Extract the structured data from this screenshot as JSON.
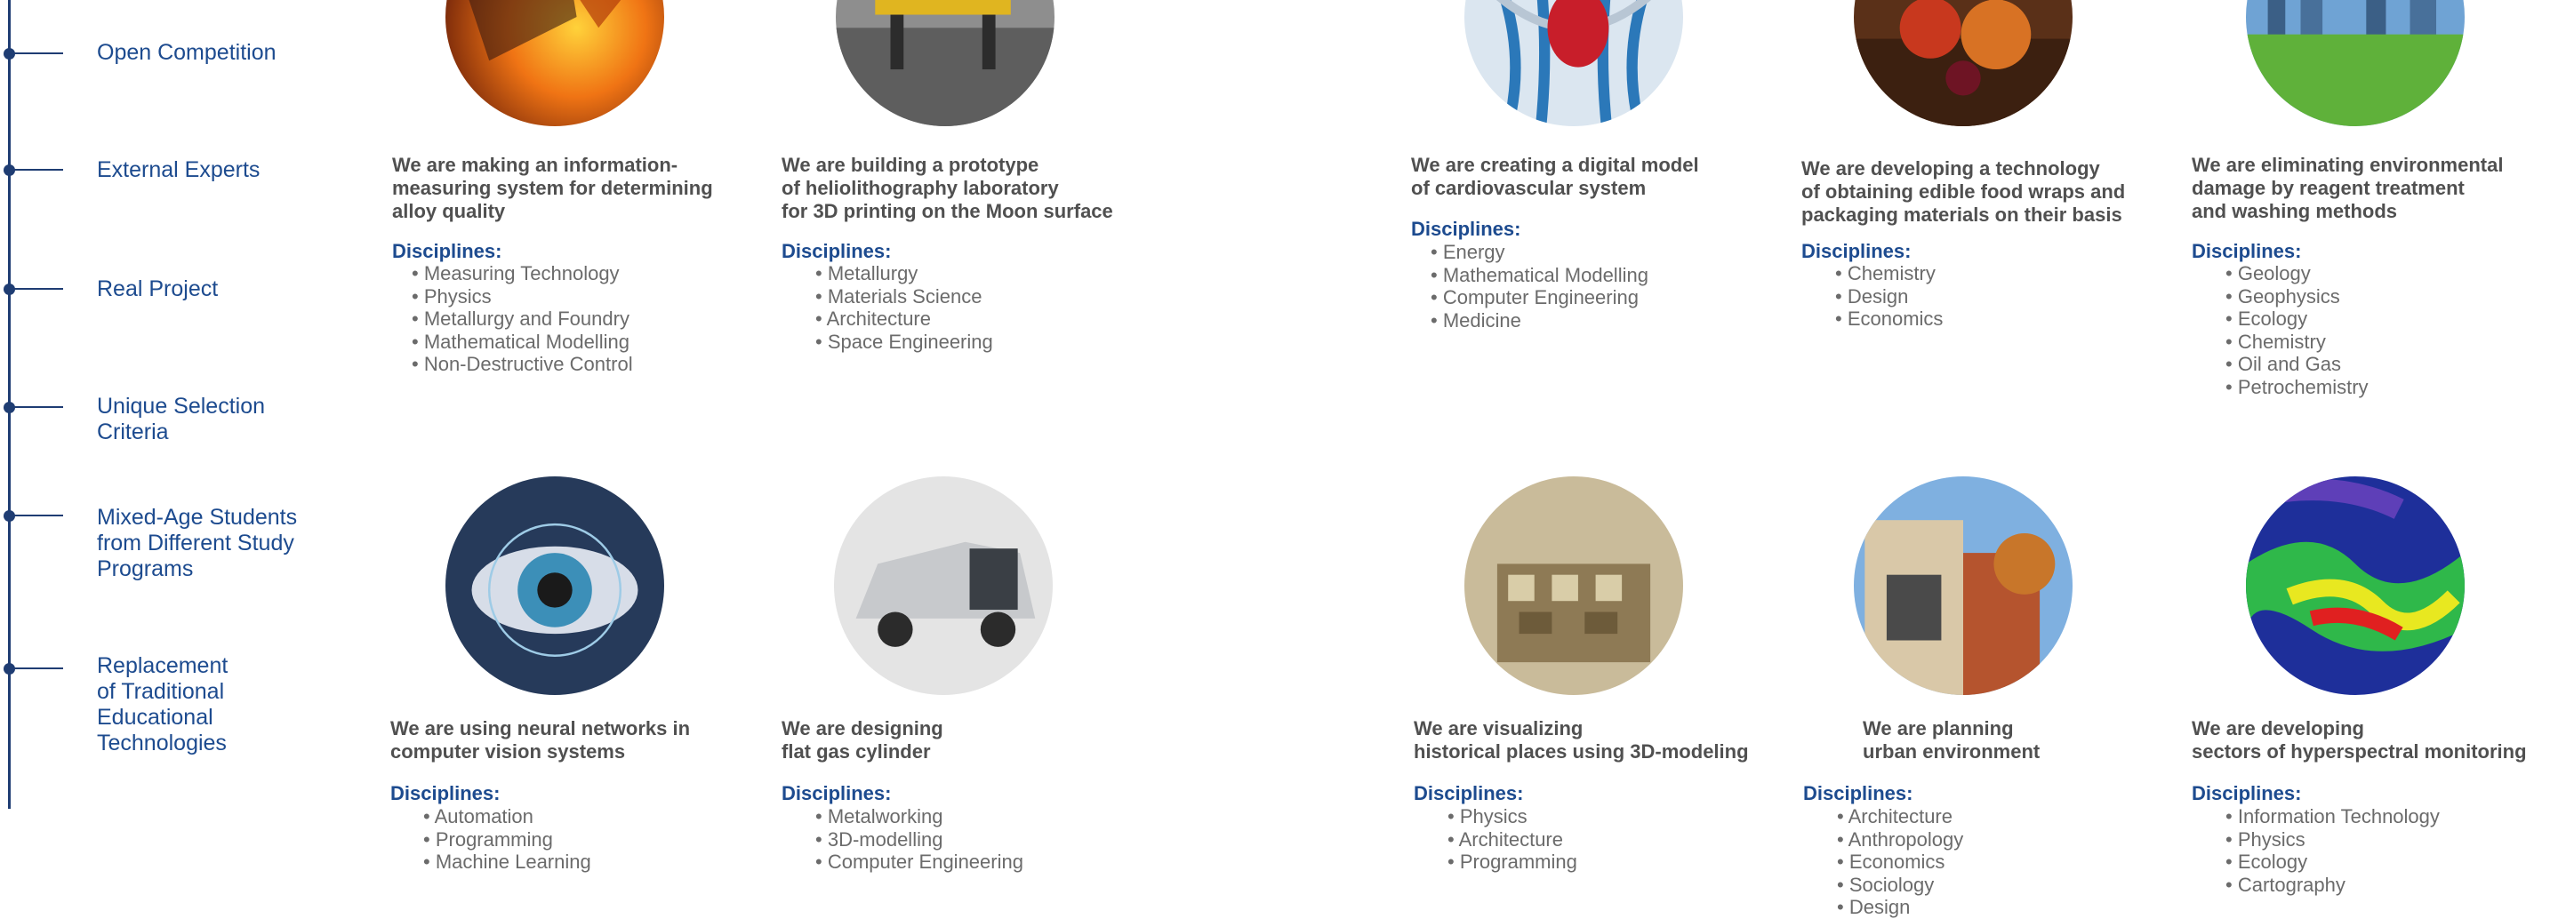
{
  "timeline": [
    {
      "label": "Open Competition"
    },
    {
      "label": "External Experts"
    },
    {
      "label": "Real Project"
    },
    {
      "label": "Unique Selection\nCriteria"
    },
    {
      "label": "Mixed-Age Students\nfrom Different Study\nPrograms"
    },
    {
      "label": "Replacement\nof Traditional\nEducational\nTechnologies"
    }
  ],
  "disciplines_heading": "Disciplines:",
  "projects": [
    {
      "title": "We are making an information-\nmeasuring system for determining\nalloy quality",
      "image": "molten-metal-image",
      "disciplines": [
        "Measuring Technology",
        "Physics",
        "Metallurgy and Foundry",
        "Mathematical Modelling",
        "Non-Destructive Control"
      ]
    },
    {
      "title": "We are building a prototype\nof heliolithography laboratory\nfor 3D printing on the Moon surface",
      "image": "lunar-rover-image",
      "disciplines": [
        "Metallurgy",
        "Materials Science",
        "Architecture",
        "Space Engineering"
      ]
    },
    {
      "title": "We are creating a digital model\nof cardiovascular system",
      "image": "cardiovascular-image",
      "disciplines": [
        "Energy",
        "Mathematical Modelling",
        "Computer Engineering",
        "Medicine"
      ]
    },
    {
      "title": "We are developing a technology\nof obtaining edible food wraps and\npackaging materials on their basis",
      "image": "fruits-image",
      "disciplines": [
        "Chemistry",
        "Design",
        "Economics"
      ]
    },
    {
      "title": "We are eliminating environmental\ndamage by reagent treatment\nand washing methods",
      "image": "green-city-image",
      "disciplines": [
        "Geology",
        "Geophysics",
        "Ecology",
        "Chemistry",
        "Oil and Gas",
        "Petrochemistry"
      ]
    },
    {
      "title": "We are using neural networks in\ncomputer vision systems",
      "image": "eye-image",
      "disciplines": [
        "Automation",
        "Programming",
        "Machine Learning"
      ]
    },
    {
      "title": "We are designing\nflat gas cylinder",
      "image": "minivan-image",
      "disciplines": [
        "Metalworking",
        "3D-modelling",
        "Computer Engineering"
      ]
    },
    {
      "title": "We are visualizing\nhistorical places using 3D-modeling",
      "image": "3d-model-image",
      "disciplines": [
        "Physics",
        "Architecture",
        "Programming"
      ]
    },
    {
      "title": "We are planning\nurban environment",
      "image": "urban-building-image",
      "disciplines": [
        "Architecture",
        "Anthropology",
        "Economics",
        "Sociology",
        "Design"
      ]
    },
    {
      "title": "We are developing\nsectors of hyperspectral monitoring",
      "image": "hyperspectral-map-image",
      "disciplines": [
        "Information Technology",
        "Physics",
        "Ecology",
        "Cartography"
      ]
    }
  ]
}
